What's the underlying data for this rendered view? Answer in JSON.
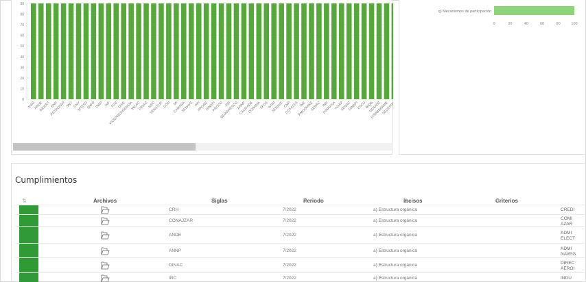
{
  "chart_data": [
    {
      "type": "bar",
      "title": "",
      "xlabel": "",
      "ylabel": "",
      "ylim": [
        0,
        90
      ],
      "yticks": [
        0,
        10,
        20,
        30,
        40,
        50,
        60,
        70,
        80,
        90
      ],
      "grid": true,
      "bar_color": "#56a83a",
      "categories": [
        "MAG",
        "ANDE",
        "INDERT",
        "ENR",
        "PETROPAR",
        "SNV",
        "CNV",
        "MTESS",
        "SNPP",
        "INAP",
        "INF",
        "FGE",
        "DISE",
        "VICEPRESIDENCIA",
        "INCAC",
        "DINAC",
        "MEC",
        "SENATUR",
        "CON",
        "MI",
        "CAMARA",
        "SENAVE",
        "PPI",
        "PRGRE",
        "DINAPI",
        "PROCO",
        "IN3",
        "SEMIARESCO",
        "ANNP",
        "CALIDADE",
        "CONAMA",
        "SFDS",
        "IVRN",
        "SENAVE",
        "CNP",
        "COYATES",
        "INE",
        "PMDOMIKE",
        "SENAC",
        "INN",
        "DINAVISA",
        "AGAP",
        "SENAC",
        "DINAPI",
        "ESCU",
        "BIDG",
        "SENADE",
        "DISABBARME",
        "SEDEPRO"
      ],
      "values": [
        90,
        90,
        90,
        90,
        90,
        90,
        90,
        90,
        90,
        90,
        90,
        90,
        90,
        90,
        90,
        90,
        90,
        90,
        90,
        90,
        90,
        90,
        90,
        90,
        90,
        90,
        90,
        90,
        90,
        90,
        90,
        90,
        90,
        90,
        90,
        90,
        90,
        90,
        90,
        90,
        90,
        90,
        90,
        90,
        90,
        90,
        90,
        90,
        90
      ]
    },
    {
      "type": "bar",
      "orientation": "horizontal",
      "categories": [
        "q) Mecanismos de participación"
      ],
      "values": [
        100
      ],
      "xlim": [
        0,
        100
      ],
      "xticks": [
        0,
        20,
        40,
        60,
        80,
        100
      ],
      "bar_color": "#8fd47a"
    }
  ],
  "cumplimientos": {
    "title": "Cumplimientos",
    "columns": {
      "status": "",
      "archivos": "Archivos",
      "siglas": "Siglas",
      "periodo": "Periodo",
      "incisos": "Incisos",
      "criterios": "Criterios"
    },
    "sort_glyph": "⇅",
    "status_color": "#2f9a36",
    "rows": [
      {
        "siglas": "CRH",
        "periodo": "7/2022",
        "inciso": "a) Estructura orgánica",
        "criterio": [
          "CREDI"
        ]
      },
      {
        "siglas": "CONAJZAR",
        "periodo": "7/2022",
        "inciso": "a) Estructura orgánica",
        "criterio": [
          "COMI",
          "AZAR"
        ]
      },
      {
        "siglas": "ANDE",
        "periodo": "7/2022",
        "inciso": "a) Estructura orgánica",
        "criterio": [
          "ADMI",
          "ELECT"
        ]
      },
      {
        "siglas": "ANNP",
        "periodo": "7/2022",
        "inciso": "a) Estructura orgánica",
        "criterio": [
          "ADMI",
          "NAVEG"
        ]
      },
      {
        "siglas": "DINAC",
        "periodo": "7/2022",
        "inciso": "a) Estructura orgánica",
        "criterio": [
          "DIREC",
          "AEROI"
        ]
      },
      {
        "siglas": "INC",
        "periodo": "7/2022",
        "inciso": "a) Estructura orgánica",
        "criterio": [
          "INDU"
        ]
      }
    ]
  }
}
